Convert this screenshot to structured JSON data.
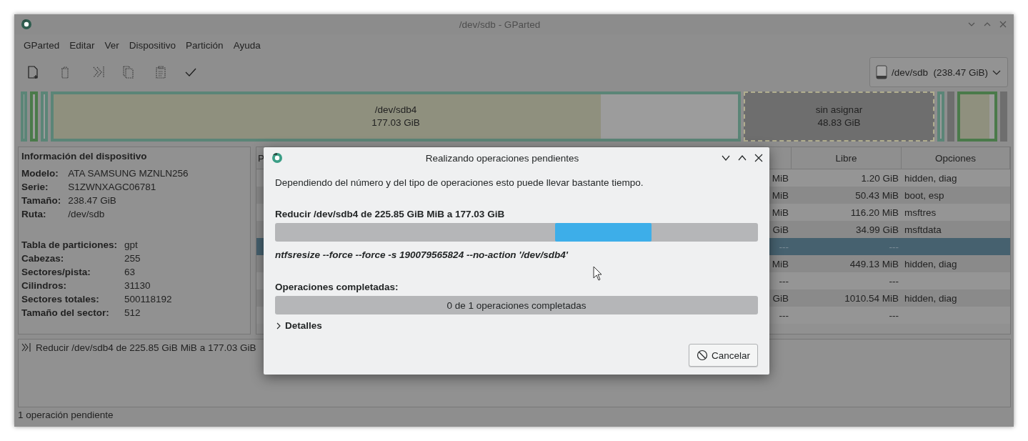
{
  "window": {
    "title": "/dev/sdb - GParted"
  },
  "menu": [
    "GParted",
    "Editar",
    "Ver",
    "Dispositivo",
    "Partición",
    "Ayuda"
  ],
  "toolbar": [
    {
      "kind": "new",
      "disabled": false
    },
    {
      "kind": "delete",
      "disabled": true
    },
    {
      "kind": "resize",
      "disabled": true
    },
    {
      "kind": "copy",
      "disabled": true
    },
    {
      "kind": "paste",
      "disabled": true
    },
    {
      "kind": "apply",
      "disabled": false
    }
  ],
  "device_selector": {
    "device": "/dev/sdb",
    "size": "(238.47 GiB)"
  },
  "partition_map": [
    {
      "kind": "partition",
      "color": "#5b8577"
    },
    {
      "kind": "partition",
      "color": "#4a7a4a"
    },
    {
      "kind": "partition",
      "color": "#5b8577"
    },
    {
      "kind": "partition",
      "color": "#5b8577",
      "level": 0.8,
      "name": "/dev/sdb4",
      "size": "177.03 GiB"
    },
    {
      "kind": "unallocated",
      "name": "sin asignar",
      "size": "48.83 GiB"
    },
    {
      "kind": "partition",
      "color": "#5b8577"
    },
    {
      "kind": "unallocated"
    },
    {
      "kind": "partition",
      "color": "#4a7a4a",
      "level": 0.85
    },
    {
      "kind": "unallocated"
    }
  ],
  "device_info": {
    "title": "Información del dispositivo",
    "groups": [
      [
        {
          "label": "Modelo:",
          "value": "ATA SAMSUNG MZNLN256"
        },
        {
          "label": "Serie:",
          "value": "S1ZWNXAGC06781"
        },
        {
          "label": "Tamaño:",
          "value": "238.47 GiB"
        },
        {
          "label": "Ruta:",
          "value": "/dev/sdb"
        }
      ],
      [
        {
          "label": "Tabla de particiones:",
          "value": "gpt"
        },
        {
          "label": "Cabezas:",
          "value": "255"
        },
        {
          "label": "Sectores/pista:",
          "value": "63"
        },
        {
          "label": "Cilindros:",
          "value": "31130"
        },
        {
          "label": "Sectores totales:",
          "value": "500118192"
        },
        {
          "label": "Tamaño del sector:",
          "value": "512"
        }
      ]
    ]
  },
  "table": {
    "columns": [
      "P",
      "Libre",
      "Opciones"
    ],
    "rows": [
      {
        "column_1": "MiB",
        "libre": "1.20 GiB",
        "opciones": "hidden, diag",
        "selected": false
      },
      {
        "column_1": "MiB",
        "libre": "50.43 MiB",
        "opciones": "boot, esp",
        "selected": false
      },
      {
        "column_1": "MiB",
        "libre": "116.20 MiB",
        "opciones": "msftres",
        "selected": false
      },
      {
        "column_1": "GiB",
        "libre": "34.99 GiB",
        "opciones": "msftdata",
        "selected": false
      },
      {
        "column_1": "---",
        "libre": "---",
        "selected": true
      },
      {
        "column_1": "MiB",
        "libre": "449.13 MiB",
        "opciones": "hidden, diag",
        "selected": false
      },
      {
        "column_1": "---",
        "libre": "---",
        "selected": false
      },
      {
        "column_1": "GiB",
        "libre": "1010.54 MiB",
        "opciones": "hidden, diag",
        "selected": false
      },
      {
        "column_1": "---",
        "libre": "---",
        "selected": false
      }
    ]
  },
  "pending_operations": [
    "Reducir /dev/sdb4 de 225.85 GiB MiB a 177.03 GiB"
  ],
  "status_bar": "1 operación pendiente",
  "dialog": {
    "title": "Realizando operaciones pendientes",
    "message": "Dependiendo del número y del tipo de operaciones esto puede llevar bastante tiempo.",
    "operation": {
      "title": "Reducir /dev/sdb4 de 225.85 GiB MiB a 177.03 GiB",
      "indeterminate": true,
      "command": "ntfsresize --force --force -s 190079565824 --no-action '/dev/sdb4'"
    },
    "completed": {
      "label": "Operaciones completadas:",
      "level": 0,
      "text": "0 de 1 operaciones completadas"
    },
    "details": {
      "label": "Detalles",
      "expanded": false
    },
    "buttons": [
      {
        "kind": "cancel",
        "label": "Cancelar"
      }
    ]
  }
}
